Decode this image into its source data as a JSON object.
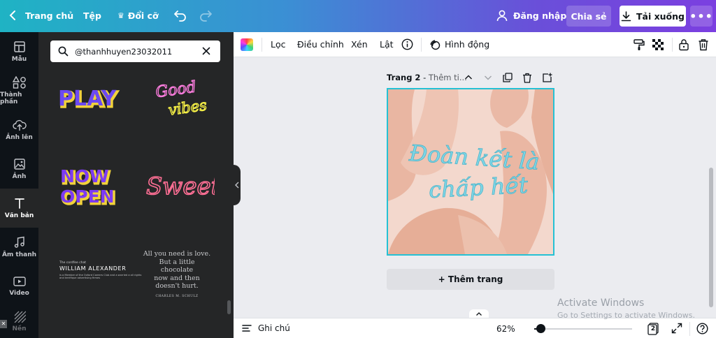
{
  "topbar": {
    "home_label": "Trang chủ",
    "file_label": "Tệp",
    "resize_label": "Đổi cỡ",
    "login_label": "Đăng nhập",
    "share_label": "Chia sẻ",
    "download_label": "Tải xuống"
  },
  "rail": {
    "items": [
      {
        "label": "Mẫu",
        "icon": "layout-icon"
      },
      {
        "label": "Thành phần",
        "icon": "shapes-icon"
      },
      {
        "label": "Ảnh lên",
        "icon": "cloud-upload-icon"
      },
      {
        "label": "Ảnh",
        "icon": "image-icon"
      },
      {
        "label": "Văn bản",
        "icon": "text-icon"
      },
      {
        "label": "Âm thanh",
        "icon": "music-icon"
      },
      {
        "label": "Video",
        "icon": "video-icon"
      },
      {
        "label": "Nền",
        "icon": "background-icon"
      }
    ],
    "active": "Văn bản"
  },
  "panel": {
    "search_value": "@thanhhuyen23032011",
    "stickers": {
      "play": "PLAY",
      "good_vibes_1": "Good",
      "good_vibes_2": "vibes",
      "now_open_1": "NOW",
      "now_open_2": "OPEN",
      "sweet": "Sweet",
      "william_small": "The cordfee chat",
      "william_name": "WILLIAM ALEXANDER",
      "william_desc_1": "is a Member of the Oxford Careers Club and a worried a all rights",
      "william_desc_2": "and terrifique advertising firmes",
      "quote_1": "All you need is love.",
      "quote_2": "But a little chocolate",
      "quote_3": "now and then",
      "quote_4": "doesn't hurt.",
      "quote_author": "CHARLES M. SCHULZ"
    }
  },
  "toolbar": {
    "filter": "Lọc",
    "adjust": "Điều chỉnh",
    "crop": "Xén",
    "flip": "Lật",
    "animate": "Hình động"
  },
  "page_header": {
    "title": "Trang 2",
    "separator": " - ",
    "subtitle": "Thêm ti..."
  },
  "canvas": {
    "line1": "Đoàn kết là",
    "line2": "chấp hết",
    "bg_color": "#f3d8cd",
    "text_color": "#7fd6e6"
  },
  "add_page_label": "+ Thêm trang",
  "bottombar": {
    "notes_label": "Ghi chú",
    "zoom": "62%",
    "zoom_fraction": 0.62,
    "page_count": "2"
  },
  "watermark": {
    "line1": "Activate Windows",
    "line2": "Go to Settings to activate Windows."
  }
}
